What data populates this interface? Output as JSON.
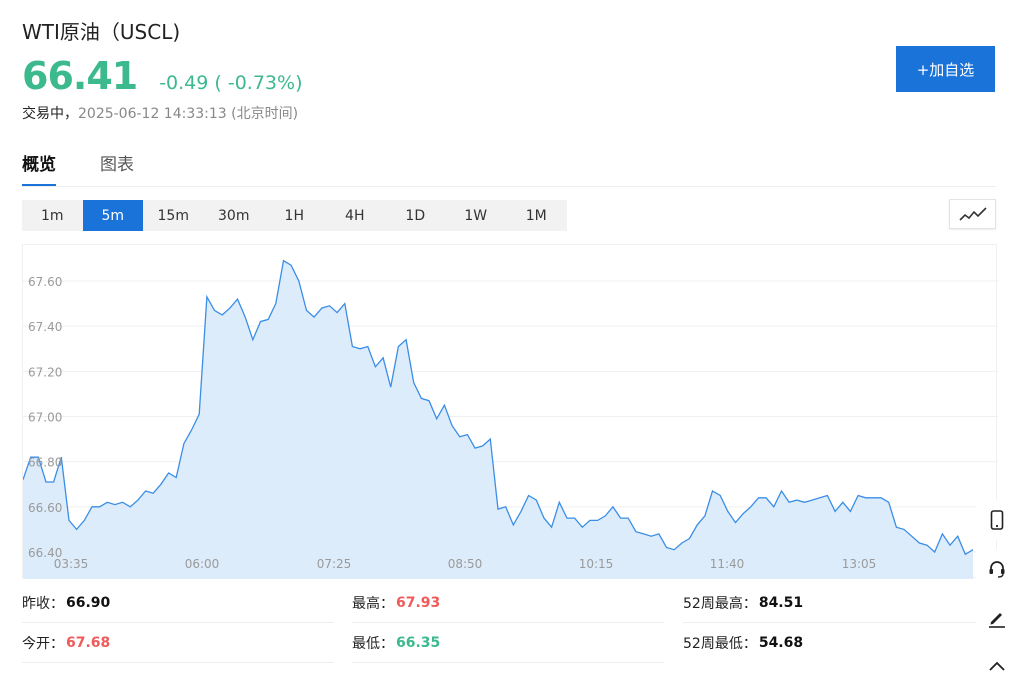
{
  "header": {
    "title": "WTI原油（USCL)",
    "price": "66.41",
    "change": "-0.49 ( -0.73%)",
    "status_state": "交易中，",
    "status_time": "2025-06-12 14:33:13 (北京时间)",
    "watch_label": "+加自选"
  },
  "tabs": [
    {
      "label": "概览",
      "active": true
    },
    {
      "label": "图表",
      "active": false
    }
  ],
  "periods": [
    {
      "label": "1m",
      "active": false
    },
    {
      "label": "5m",
      "active": true
    },
    {
      "label": "15m",
      "active": false
    },
    {
      "label": "30m",
      "active": false
    },
    {
      "label": "1H",
      "active": false
    },
    {
      "label": "4H",
      "active": false
    },
    {
      "label": "1D",
      "active": false
    },
    {
      "label": "1W",
      "active": false
    },
    {
      "label": "1M",
      "active": false
    }
  ],
  "chart_type_icon": "line-chart-icon",
  "colors": {
    "accent": "#1a73d9",
    "up": "#f05a5a",
    "down": "#3cb98d",
    "line": "#3a8ee6",
    "fill": "#ddecfb"
  },
  "chart_data": {
    "type": "area",
    "x_ticks": [
      "03:35",
      "06:00",
      "07:25",
      "08:50",
      "10:15",
      "11:40",
      "13:05"
    ],
    "y_ticks": [
      "67.60",
      "67.40",
      "67.20",
      "67.00",
      "66.80",
      "66.60",
      "66.40"
    ],
    "ylim": [
      66.4,
      67.73
    ],
    "grid": true,
    "values": [
      66.72,
      66.82,
      66.82,
      66.71,
      66.71,
      66.82,
      66.54,
      66.5,
      66.54,
      66.6,
      66.6,
      66.62,
      66.61,
      66.62,
      66.6,
      66.63,
      66.67,
      66.66,
      66.7,
      66.75,
      66.73,
      66.88,
      66.94,
      67.01,
      67.53,
      67.47,
      67.45,
      67.48,
      67.52,
      67.44,
      67.34,
      67.42,
      67.43,
      67.5,
      67.69,
      67.67,
      67.6,
      67.47,
      67.44,
      67.48,
      67.49,
      67.46,
      67.5,
      67.31,
      67.3,
      67.31,
      67.22,
      67.26,
      67.13,
      67.31,
      67.34,
      67.15,
      67.08,
      67.07,
      66.99,
      67.05,
      66.96,
      66.91,
      66.92,
      66.86,
      66.87,
      66.9,
      66.59,
      66.6,
      66.52,
      66.58,
      66.65,
      66.63,
      66.55,
      66.51,
      66.62,
      66.55,
      66.55,
      66.51,
      66.54,
      66.54,
      66.56,
      66.6,
      66.55,
      66.55,
      66.49,
      66.48,
      66.47,
      66.48,
      66.42,
      66.41,
      66.44,
      66.46,
      66.52,
      66.56,
      66.67,
      66.65,
      66.58,
      66.53,
      66.57,
      66.6,
      66.64,
      66.64,
      66.6,
      66.67,
      66.62,
      66.63,
      66.62,
      66.63,
      66.64,
      66.65,
      66.58,
      66.62,
      66.58,
      66.65,
      66.64,
      66.64,
      66.64,
      66.62,
      66.51,
      66.5,
      66.47,
      66.44,
      66.43,
      66.4,
      66.48,
      66.43,
      66.47,
      66.39,
      66.41
    ]
  },
  "stats": [
    {
      "label": "昨收：",
      "value": "66.90",
      "tone": "dark"
    },
    {
      "label": "最高：",
      "value": "67.93",
      "tone": "red"
    },
    {
      "label": "52周最高：",
      "value": "84.51",
      "tone": "dark"
    },
    {
      "label": "今开：",
      "value": "67.68",
      "tone": "red"
    },
    {
      "label": "最低：",
      "value": "66.35",
      "tone": "green"
    },
    {
      "label": "52周最低：",
      "value": "54.68",
      "tone": "dark"
    }
  ],
  "side_tools": [
    "mobile-icon",
    "headset-icon",
    "pen-icon",
    "chevron-up-icon"
  ]
}
